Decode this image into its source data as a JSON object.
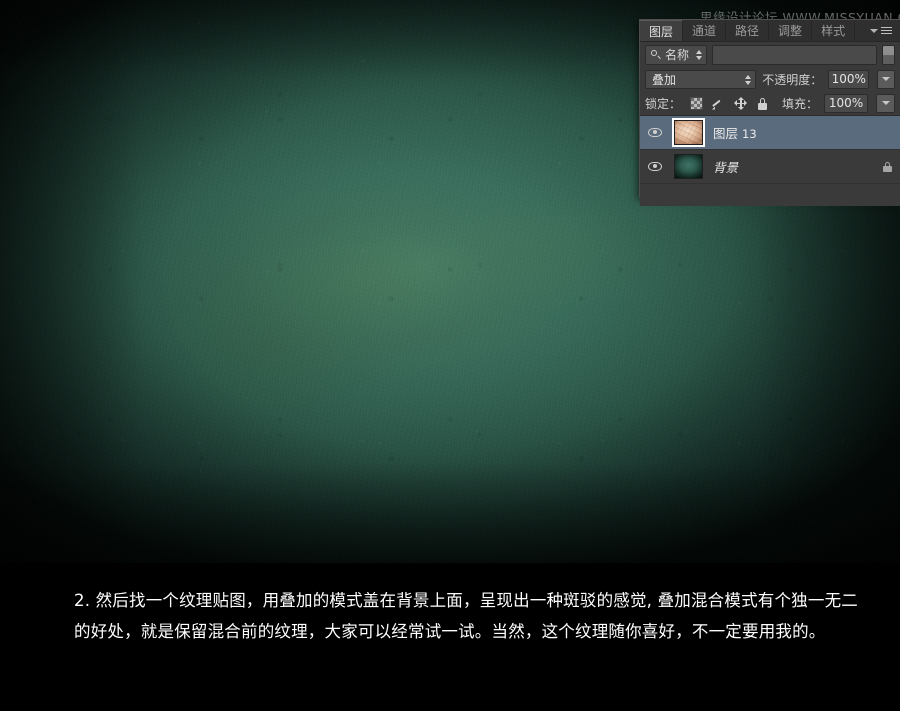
{
  "watermark": {
    "text": "思缘设计论坛 WWW.MISSYUAN.COM"
  },
  "canvas": {
    "name": "textured-teal-background-image",
    "base_color": "#3a6e5d",
    "center_color": "#47806c",
    "edge_color": "#07120f"
  },
  "panel": {
    "title": "图层",
    "tabs": [
      {
        "label": "图层",
        "active": true
      },
      {
        "label": "通道",
        "active": false
      },
      {
        "label": "路径",
        "active": false
      },
      {
        "label": "调整",
        "active": false
      },
      {
        "label": "样式",
        "active": false
      }
    ],
    "menu_icon": "panel-menu-icon",
    "filter": {
      "kind_label": "名称",
      "search_icon": "search-icon",
      "input_value": "",
      "toggle_icon": "filter-toggle-icon"
    },
    "blend": {
      "mode": "叠加",
      "opacity_label": "不透明度：",
      "opacity_value": "100%"
    },
    "lock": {
      "label": "锁定：",
      "icons": [
        "lock-transparent-pixels-icon",
        "lock-image-pixels-icon",
        "lock-position-icon",
        "lock-all-icon"
      ],
      "fill_label": "填充：",
      "fill_value": "100%"
    },
    "layers": [
      {
        "name": "图层",
        "number": "13",
        "visible": true,
        "selected": true,
        "locked": false,
        "thumb": "texture-thumbnail"
      },
      {
        "name": "背景",
        "number": "",
        "visible": true,
        "selected": false,
        "locked": true,
        "thumb": "background-thumbnail"
      }
    ]
  },
  "caption": {
    "text": "2. 然后找一个纹理贴图，用叠加的模式盖在背景上面，呈现出一种斑驳的感觉, 叠加混合模式有个独一无二的好处，就是保留混合前的纹理，大家可以经常试一试。当然，这个纹理随你喜好，不一定要用我的。"
  }
}
